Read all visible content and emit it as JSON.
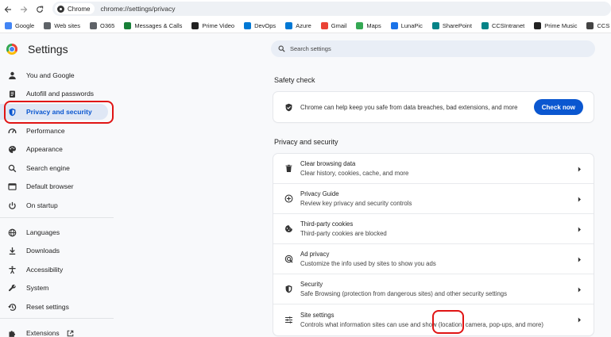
{
  "browser": {
    "chip_label": "Chrome",
    "url": "chrome://settings/privacy"
  },
  "bookmarks": [
    {
      "label": "Google",
      "icon": "google-icon",
      "color": "#4285f4"
    },
    {
      "label": "Web sites",
      "icon": "folder-icon",
      "color": "#5f6368"
    },
    {
      "label": "O365",
      "icon": "folder-icon",
      "color": "#5f6368"
    },
    {
      "label": "Messages & Calls",
      "icon": "messages-icon",
      "color": "#188038"
    },
    {
      "label": "Prime Video",
      "icon": "amazon-icon",
      "color": "#222222"
    },
    {
      "label": "DevOps",
      "icon": "devops-icon",
      "color": "#0078d4"
    },
    {
      "label": "Azure",
      "icon": "azure-icon",
      "color": "#0078d4"
    },
    {
      "label": "Gmail",
      "icon": "gmail-icon",
      "color": "#ea4335"
    },
    {
      "label": "Maps",
      "icon": "maps-icon",
      "color": "#34a853"
    },
    {
      "label": "LunaPic",
      "icon": "lunapic-icon",
      "color": "#1a73e8"
    },
    {
      "label": "SharePoint",
      "icon": "sharepoint-icon",
      "color": "#038387"
    },
    {
      "label": "CCSIntranet",
      "icon": "sharepoint-icon",
      "color": "#038387"
    },
    {
      "label": "Prime Music",
      "icon": "amazon-icon",
      "color": "#222222"
    },
    {
      "label": "CCS Management",
      "icon": "ccs-icon",
      "color": "#444444"
    }
  ],
  "sidebar": {
    "title": "Settings",
    "items": [
      {
        "label": "You and Google",
        "icon": "person-icon"
      },
      {
        "label": "Autofill and passwords",
        "icon": "clipboard-icon"
      },
      {
        "label": "Privacy and security",
        "icon": "shield-icon",
        "active": true
      },
      {
        "label": "Performance",
        "icon": "speedometer-icon"
      },
      {
        "label": "Appearance",
        "icon": "palette-icon"
      },
      {
        "label": "Search engine",
        "icon": "search-icon"
      },
      {
        "label": "Default browser",
        "icon": "browser-icon"
      },
      {
        "label": "On startup",
        "icon": "power-icon"
      },
      {
        "label": "Languages",
        "icon": "globe-icon"
      },
      {
        "label": "Downloads",
        "icon": "download-icon"
      },
      {
        "label": "Accessibility",
        "icon": "accessibility-icon"
      },
      {
        "label": "System",
        "icon": "wrench-icon"
      },
      {
        "label": "Reset settings",
        "icon": "history-icon"
      },
      {
        "label": "Extensions",
        "icon": "puzzle-icon"
      }
    ]
  },
  "search": {
    "placeholder": "Search settings"
  },
  "safety_check": {
    "title": "Safety check",
    "text": "Chrome can help keep you safe from data breaches, bad extensions, and more",
    "button": "Check now"
  },
  "privacy": {
    "title": "Privacy and security",
    "rows": [
      {
        "title": "Clear browsing data",
        "desc": "Clear history, cookies, cache, and more",
        "icon": "trash-icon"
      },
      {
        "title": "Privacy Guide",
        "desc": "Review key privacy and security controls",
        "icon": "compass-icon"
      },
      {
        "title": "Third-party cookies",
        "desc": "Third-party cookies are blocked",
        "icon": "cookie-icon"
      },
      {
        "title": "Ad privacy",
        "desc": "Customize the info used by sites to show you ads",
        "icon": "ad-privacy-icon"
      },
      {
        "title": "Security",
        "desc": "Safe Browsing (protection from dangerous sites) and other security settings",
        "icon": "security-icon"
      },
      {
        "title": "Site settings",
        "desc": "Controls what information sites can use and show (location, camera, pop-ups, and more)",
        "icon": "sliders-icon"
      }
    ]
  },
  "colors": {
    "accent": "#0b57d0",
    "active_bg": "#dfe7f5",
    "highlight": "#e01414"
  }
}
